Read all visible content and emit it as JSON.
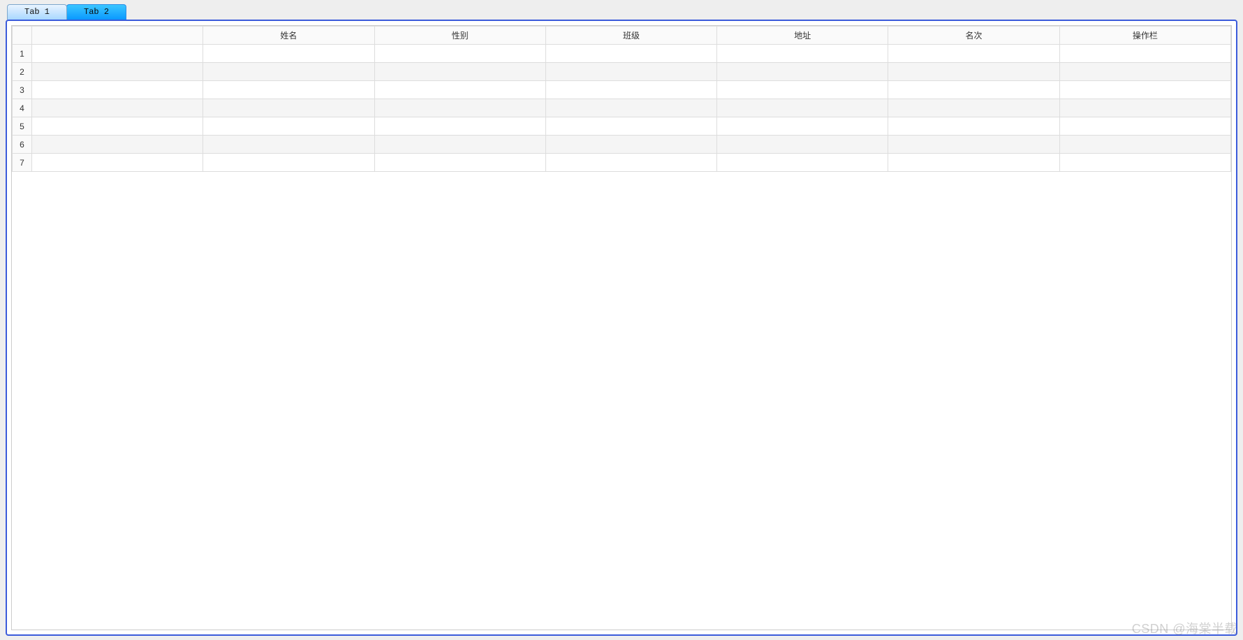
{
  "tabs": [
    {
      "label": "Tab 1",
      "active": true
    },
    {
      "label": "Tab 2",
      "active": false
    }
  ],
  "table": {
    "columns": [
      "姓名",
      "性别",
      "班级",
      "地址",
      "名次",
      "操作栏"
    ],
    "rows": [
      {
        "num": "1",
        "cells": [
          "",
          "",
          "",
          "",
          "",
          ""
        ]
      },
      {
        "num": "2",
        "cells": [
          "",
          "",
          "",
          "",
          "",
          ""
        ]
      },
      {
        "num": "3",
        "cells": [
          "",
          "",
          "",
          "",
          "",
          ""
        ]
      },
      {
        "num": "4",
        "cells": [
          "",
          "",
          "",
          "",
          "",
          ""
        ]
      },
      {
        "num": "5",
        "cells": [
          "",
          "",
          "",
          "",
          "",
          ""
        ]
      },
      {
        "num": "6",
        "cells": [
          "",
          "",
          "",
          "",
          "",
          ""
        ]
      },
      {
        "num": "7",
        "cells": [
          "",
          "",
          "",
          "",
          "",
          ""
        ]
      }
    ]
  },
  "watermark": "CSDN @海棠半载"
}
